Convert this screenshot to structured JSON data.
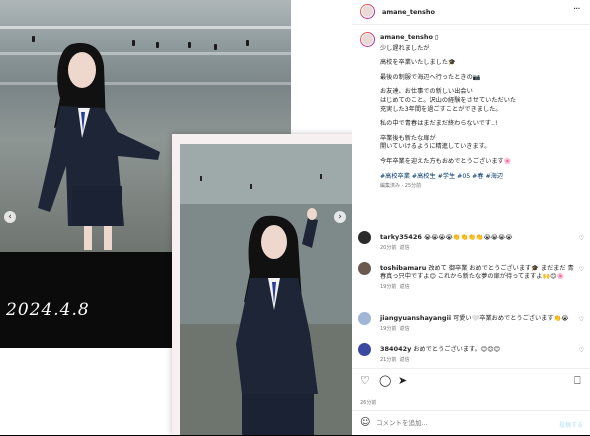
{
  "media": {
    "date_overlay": "2024.4.8"
  },
  "header": {
    "username": "amane_tensho",
    "verified_glyph": "▯",
    "more_icon": "more-icon"
  },
  "caption": {
    "username": "amane_tensho",
    "verified_glyph": "▯",
    "lines": [
      "少し遅れましたが",
      "高校を卒業いたしました🎓",
      "最後の制服で海辺へ行ったときの📷",
      "お友達、お仕事での新しい出会い",
      "はじめてのこと。沢山の経験をさせていただいた",
      "充実した3年間を過ごすことができました。",
      "私の中で青春はまだまだ終わらないです..!",
      "卒業後も新たな扉が",
      "開いていけるように精進していきます。",
      "今年卒業を迎えた方もおめでとうございます🌸"
    ],
    "hashtags": "#高校卒業 #高校生 #学生 #05 #春 #海辺",
    "meta": "編集済み · 25分前"
  },
  "comments": [
    {
      "username": "tarky35426",
      "text": "😭😭😭😭👏👏👏👏😭😭😭😭",
      "time": "20分前",
      "reply": "返信"
    },
    {
      "username": "toshibamaru",
      "text": "改めて 御卒業 おめでとうございます🎓 まだまだ 青春真っ只中ですよ😊 これから新たな夢の扉が待ってますよ🙌😊🌸",
      "time": "19分前",
      "reply": "返信"
    },
    {
      "username": "jiangyuanshayangii",
      "text": "可愛い🤍卒業おめでとうございます👏😭",
      "time": "19分前",
      "reply": "返信"
    },
    {
      "username": "384042y",
      "text": "おめでとうございます。😊😊😊",
      "time": "21分前",
      "reply": "返信"
    }
  ],
  "actions": {
    "time": "26分前"
  },
  "add_comment": {
    "placeholder": "コメントを追加...",
    "post_label": "投稿する"
  },
  "colors": {
    "link": "#00376b",
    "post_button": "#b2dffc"
  }
}
